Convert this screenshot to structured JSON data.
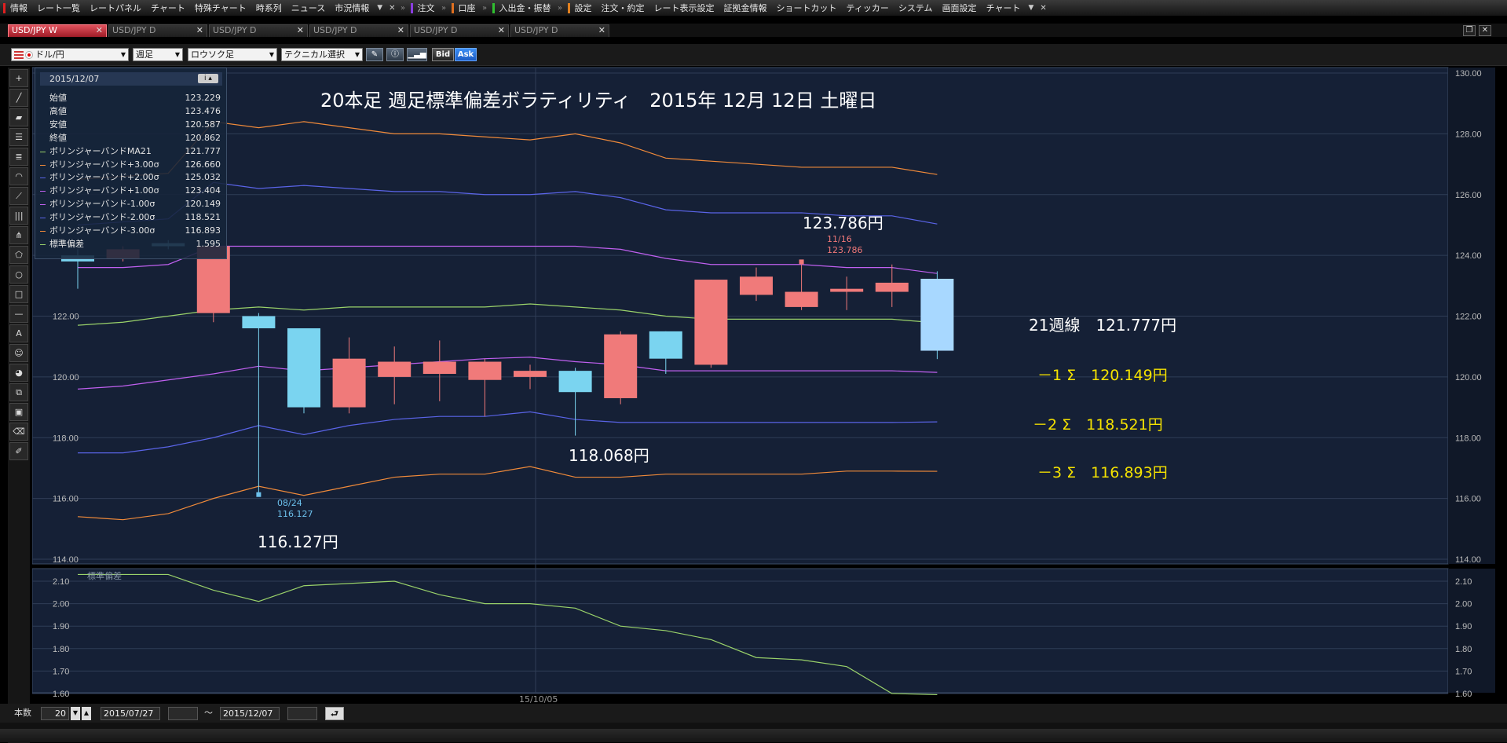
{
  "menubar": {
    "items": [
      {
        "label": "情報",
        "bar": "#e02020"
      },
      {
        "label": "レート一覧"
      },
      {
        "label": "レートパネル"
      },
      {
        "label": "チャート"
      },
      {
        "label": "特殊チャート"
      },
      {
        "label": "時系列"
      },
      {
        "label": "ニュース"
      },
      {
        "label": "市況情報"
      },
      {
        "label": "注文",
        "bar": "#8a3de0"
      },
      {
        "label": "口座",
        "bar": "#e07020"
      },
      {
        "label": "入出金・振替",
        "bar": "#30c030"
      },
      {
        "label": "設定",
        "bar": "#e08020"
      },
      {
        "label": "注文・約定"
      },
      {
        "label": "レート表示設定"
      },
      {
        "label": "証拠金情報"
      },
      {
        "label": "ショートカット"
      },
      {
        "label": "ティッカー"
      },
      {
        "label": "システム"
      },
      {
        "label": "画面設定"
      },
      {
        "label": "チャート"
      }
    ]
  },
  "tabs": [
    {
      "label": "USD/JPY W",
      "active": true
    },
    {
      "label": "USD/JPY D"
    },
    {
      "label": "USD/JPY D"
    },
    {
      "label": "USD/JPY D"
    },
    {
      "label": "USD/JPY D"
    },
    {
      "label": "USD/JPY D"
    }
  ],
  "toolbar": {
    "pair": "ドル/円",
    "period": "週足",
    "chart_type": "ロウソク足",
    "technical": "テクニカル選択",
    "bid": "Bid",
    "ask": "Ask"
  },
  "infopanel": {
    "date": "2015/12/07",
    "rows": [
      {
        "name": "始値",
        "value": "123.229",
        "color": ""
      },
      {
        "name": "高値",
        "value": "123.476",
        "color": ""
      },
      {
        "name": "安値",
        "value": "120.587",
        "color": ""
      },
      {
        "name": "終値",
        "value": "120.862",
        "color": ""
      },
      {
        "name": "ボリンジャーバンドMA21",
        "value": "121.777",
        "color": "#9ad26a"
      },
      {
        "name": "ボリンジャーバンド+3.00σ",
        "value": "126.660",
        "color": "#f08a3a"
      },
      {
        "name": "ボリンジャーバンド+2.00σ",
        "value": "125.032",
        "color": "#5a64e8"
      },
      {
        "name": "ボリンジャーバンド+1.00σ",
        "value": "123.404",
        "color": "#c060f0"
      },
      {
        "name": "ボリンジャーバンド-1.00σ",
        "value": "120.149",
        "color": "#c060f0"
      },
      {
        "name": "ボリンジャーバンド-2.00σ",
        "value": "118.521",
        "color": "#5a64e8"
      },
      {
        "name": "ボリンジャーバンド-3.00σ",
        "value": "116.893",
        "color": "#f08a3a"
      },
      {
        "name": "標準偏差",
        "value": "1.595",
        "color": "#9ad26a"
      }
    ]
  },
  "annotations": {
    "title": "20本足 週足標準偏差ボラティリティ　2015年 12月 12日 土曜日",
    "high_price": "123.786円",
    "mid_low_price": "118.068円",
    "low_price": "116.127円",
    "ma21": "21週線　121.777円",
    "minus1": "－1 Σ　120.149円",
    "minus2": "－2 Σ　118.521円",
    "minus3": "－3 Σ　116.893円",
    "high_marker_date": "11/16",
    "high_marker_value": "123.786",
    "low_marker_date": "08/24",
    "low_marker_value": "116.127",
    "sub_label": "標準偏差",
    "x_label": "15/10/05"
  },
  "bottombar": {
    "count_label": "本数",
    "count": "20",
    "from": "2015/07/27",
    "tilde": "～",
    "to": "2015/12/07"
  },
  "chart_data": [
    {
      "type": "candlestick",
      "ylim": [
        114,
        130
      ],
      "yticks": [
        "130.00",
        "128.00",
        "126.00",
        "124.00",
        "122.00",
        "120.00",
        "118.00",
        "116.00",
        "114.00"
      ],
      "candles": [
        {
          "o": 124.0,
          "h": 124.2,
          "l": 122.9,
          "c": 123.8
        },
        {
          "o": 123.9,
          "h": 124.3,
          "l": 123.8,
          "c": 124.2
        },
        {
          "o": 124.4,
          "h": 124.5,
          "l": 124.2,
          "c": 124.3
        },
        {
          "o": 122.1,
          "h": 124.5,
          "l": 121.8,
          "c": 124.3
        },
        {
          "o": 122.0,
          "h": 122.1,
          "l": 116.127,
          "c": 121.6
        },
        {
          "o": 121.6,
          "h": 121.6,
          "l": 118.8,
          "c": 119.0
        },
        {
          "o": 119.0,
          "h": 121.3,
          "l": 118.8,
          "c": 120.6
        },
        {
          "o": 120.0,
          "h": 121.0,
          "l": 119.1,
          "c": 120.5
        },
        {
          "o": 120.1,
          "h": 121.2,
          "l": 119.2,
          "c": 120.5
        },
        {
          "o": 119.9,
          "h": 120.6,
          "l": 118.7,
          "c": 120.5
        },
        {
          "o": 120.0,
          "h": 120.4,
          "l": 119.6,
          "c": 120.2
        },
        {
          "o": 120.2,
          "h": 120.3,
          "l": 118.068,
          "c": 119.5
        },
        {
          "o": 119.3,
          "h": 121.5,
          "l": 119.1,
          "c": 121.4
        },
        {
          "o": 121.5,
          "h": 121.5,
          "l": 120.1,
          "c": 120.6
        },
        {
          "o": 120.4,
          "h": 123.2,
          "l": 120.3,
          "c": 123.2
        },
        {
          "o": 122.7,
          "h": 123.6,
          "l": 122.5,
          "c": 123.3
        },
        {
          "o": 122.3,
          "h": 123.786,
          "l": 122.2,
          "c": 122.8
        },
        {
          "o": 122.8,
          "h": 123.3,
          "l": 122.2,
          "c": 122.9
        },
        {
          "o": 122.8,
          "h": 123.7,
          "l": 122.3,
          "c": 123.1
        },
        {
          "o": 123.229,
          "h": 123.476,
          "l": 120.587,
          "c": 120.862
        }
      ],
      "series": [
        {
          "key": "p3",
          "values": [
            126.5,
            126.6,
            126.7,
            128.4,
            128.2,
            128.4,
            128.2,
            128.0,
            128.0,
            127.9,
            127.8,
            128.0,
            127.7,
            127.2,
            127.1,
            127.0,
            126.9,
            126.9,
            126.9,
            126.66
          ]
        },
        {
          "key": "p2",
          "values": [
            125.0,
            125.1,
            125.2,
            126.4,
            126.2,
            126.3,
            126.2,
            126.1,
            126.1,
            126.0,
            126.0,
            126.1,
            125.9,
            125.5,
            125.4,
            125.4,
            125.4,
            125.3,
            125.3,
            125.032
          ]
        },
        {
          "key": "p1",
          "values": [
            123.6,
            123.6,
            123.7,
            124.3,
            124.3,
            124.3,
            124.3,
            124.3,
            124.3,
            124.3,
            124.3,
            124.3,
            124.2,
            123.9,
            123.7,
            123.7,
            123.7,
            123.6,
            123.6,
            123.404
          ]
        },
        {
          "key": "ma",
          "values": [
            121.7,
            121.8,
            122.0,
            122.2,
            122.3,
            122.2,
            122.3,
            122.3,
            122.3,
            122.3,
            122.4,
            122.3,
            122.2,
            122.0,
            121.9,
            121.9,
            121.9,
            121.9,
            121.9,
            121.777
          ]
        },
        {
          "key": "m1",
          "values": [
            119.6,
            119.7,
            119.9,
            120.1,
            120.35,
            120.2,
            120.3,
            120.4,
            120.5,
            120.6,
            120.65,
            120.5,
            120.4,
            120.2,
            120.2,
            120.2,
            120.2,
            120.2,
            120.2,
            120.149
          ]
        },
        {
          "key": "m2",
          "values": [
            117.5,
            117.5,
            117.7,
            118.0,
            118.4,
            118.1,
            118.4,
            118.6,
            118.7,
            118.7,
            118.85,
            118.6,
            118.5,
            118.5,
            118.5,
            118.5,
            118.5,
            118.5,
            118.5,
            118.521
          ]
        },
        {
          "key": "m3",
          "values": [
            115.4,
            115.3,
            115.5,
            116.0,
            116.4,
            116.1,
            116.4,
            116.7,
            116.8,
            116.8,
            117.05,
            116.7,
            116.7,
            116.8,
            116.8,
            116.8,
            116.8,
            116.9,
            116.9,
            116.893
          ]
        }
      ]
    },
    {
      "type": "line",
      "ylim": [
        1.55,
        2.15
      ],
      "yticks": [
        "2.10",
        "2.00",
        "1.90",
        "1.80",
        "1.70",
        "1.60"
      ],
      "series": [
        {
          "key": "sd",
          "values": [
            2.13,
            2.13,
            2.13,
            2.06,
            2.01,
            2.08,
            2.09,
            2.1,
            2.04,
            2.0,
            2.0,
            1.98,
            1.9,
            1.88,
            1.84,
            1.76,
            1.75,
            1.72,
            1.6,
            1.595
          ]
        }
      ]
    }
  ]
}
